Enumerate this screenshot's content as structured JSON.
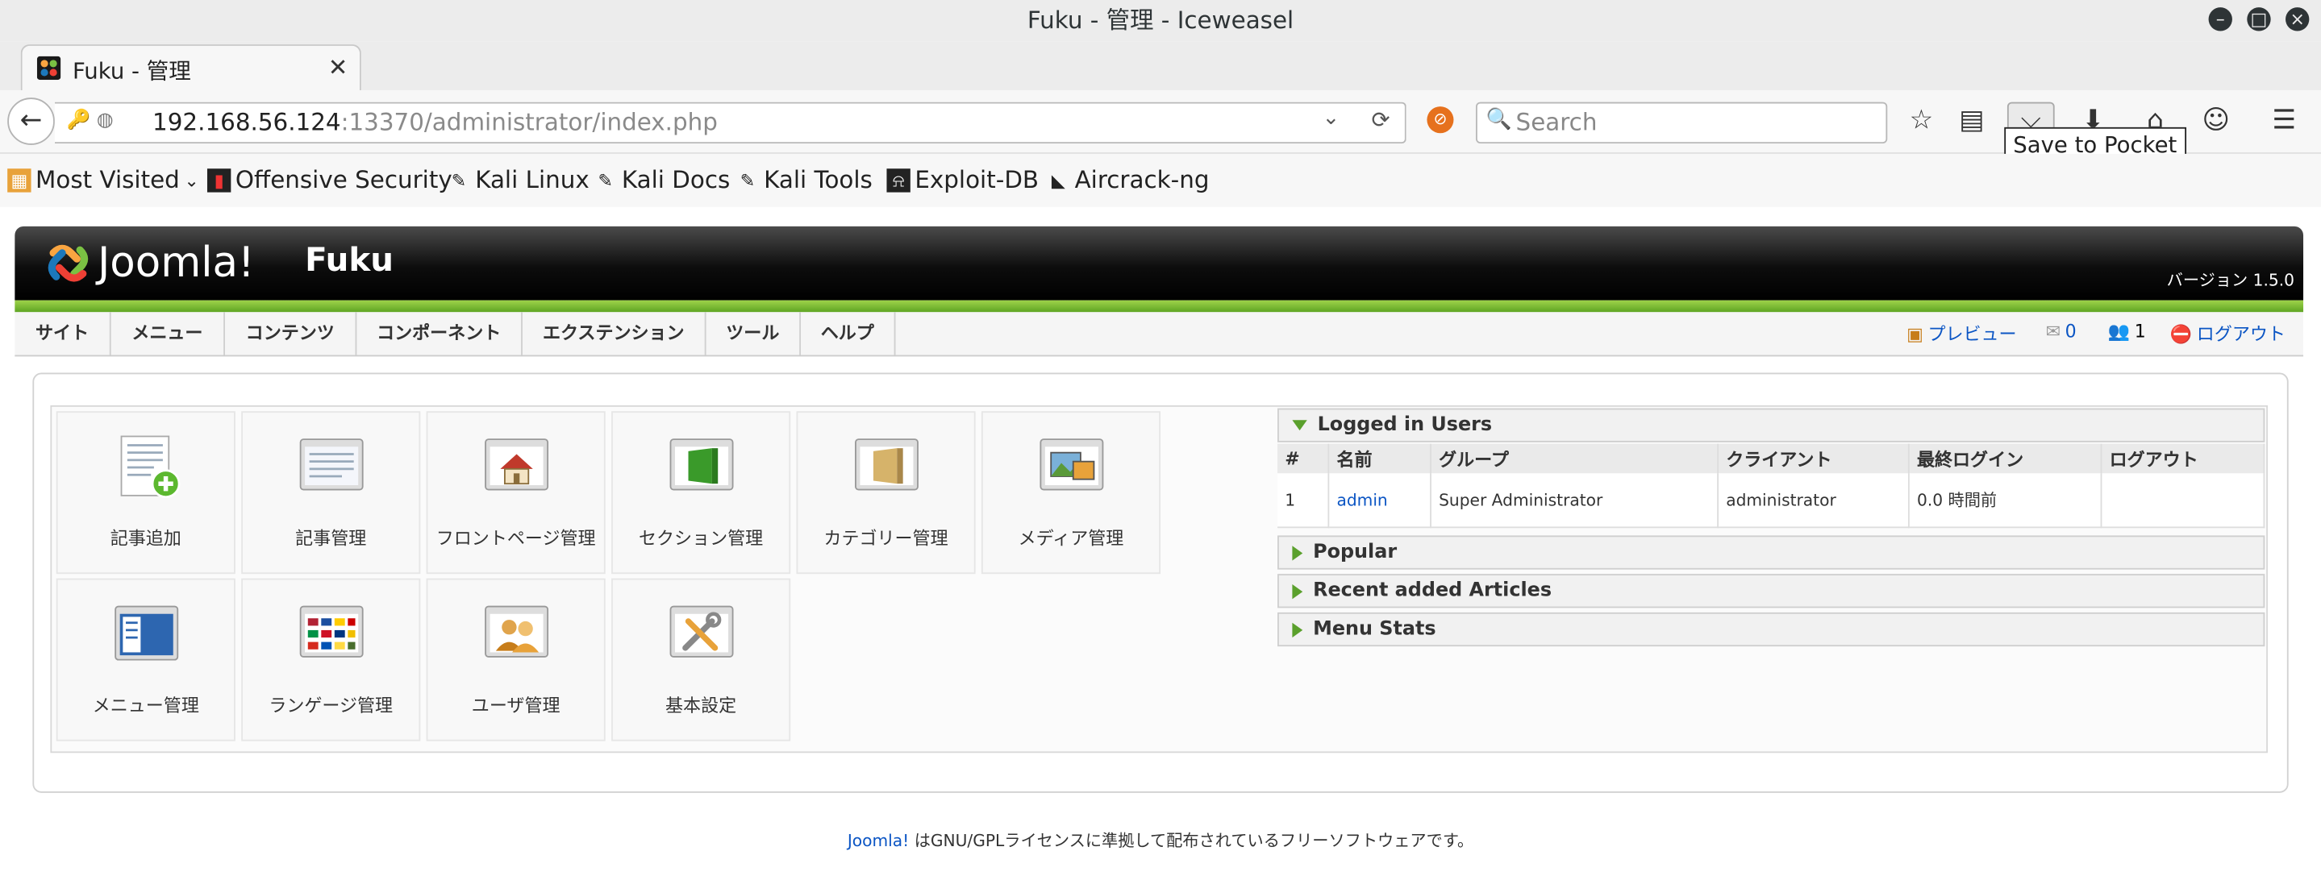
{
  "window": {
    "title": "Fuku - 管理 - Iceweasel"
  },
  "tab": {
    "title": "Fuku - 管理",
    "close": "✕",
    "new_tab": "✚"
  },
  "navbar": {
    "url_host": "192.168.56.124",
    "url_rest": ":13370/administrator/index.php",
    "search_placeholder": "Search",
    "pocket_tooltip": "Save to Pocket"
  },
  "bookmarks": [
    {
      "label": "Most Visited"
    },
    {
      "label": "Offensive Security"
    },
    {
      "label": "Kali Linux"
    },
    {
      "label": "Kali Docs"
    },
    {
      "label": "Kali Tools"
    },
    {
      "label": "Exploit-DB"
    },
    {
      "label": "Aircrack-ng"
    }
  ],
  "joomla": {
    "logo_text": "Joomla!",
    "site_name": "Fuku",
    "version": "バージョン 1.5.0",
    "menu": [
      "サイト",
      "メニュー",
      "コンテンツ",
      "コンポーネント",
      "エクステンション",
      "ツール",
      "ヘルプ"
    ],
    "status": {
      "preview": "プレビュー",
      "messages": "0",
      "users": "1",
      "logout": "ログアウト"
    },
    "quickicons": [
      "記事追加",
      "記事管理",
      "フロントページ管理",
      "セクション管理",
      "カテゴリー管理",
      "メディア管理",
      "メニュー管理",
      "ランゲージ管理",
      "ユーザ管理",
      "基本設定"
    ],
    "panels": {
      "logged_in": "Logged in Users",
      "popular": "Popular",
      "recent": "Recent added Articles",
      "menu_stats": "Menu Stats"
    },
    "logged_table": {
      "headers": [
        "#",
        "名前",
        "グループ",
        "クライアント",
        "最終ログイン",
        "ログアウト"
      ],
      "rows": [
        {
          "num": "1",
          "name": "admin",
          "group": "Super Administrator",
          "client": "administrator",
          "last": "0.0 時間前",
          "logout": ""
        }
      ]
    },
    "footer": {
      "link": "Joomla!",
      "text": " はGNU/GPLライセンスに準拠して配布されているフリーソフトウェアです。"
    }
  }
}
